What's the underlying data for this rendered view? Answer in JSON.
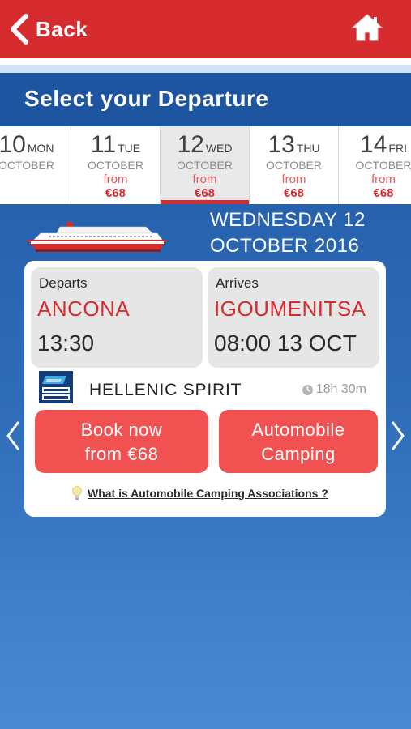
{
  "topbar": {
    "back_label": "Back",
    "home_icon": "home-icon"
  },
  "header": {
    "title": "Select your Departure"
  },
  "dates": [
    {
      "num": "10",
      "day": "MON",
      "month": "OCTOBER",
      "from": "",
      "price": ""
    },
    {
      "num": "11",
      "day": "TUE",
      "month": "OCTOBER",
      "from": "from",
      "price": "€68"
    },
    {
      "num": "12",
      "day": "WED",
      "month": "OCTOBER",
      "from": "from",
      "price": "€68",
      "selected": true
    },
    {
      "num": "13",
      "day": "THU",
      "month": "OCTOBER",
      "from": "from",
      "price": "€68"
    },
    {
      "num": "14",
      "day": "FRI",
      "month": "OCTOBER",
      "from": "from",
      "price": "€68"
    }
  ],
  "selected_date": {
    "line1": "WEDNESDAY 12",
    "line2": "OCTOBER 2016"
  },
  "trip": {
    "departs_label": "Departs",
    "departs_city": "ANCONA",
    "departs_time": "13:30",
    "arrives_label": "Arrives",
    "arrives_city": "IGOUMENITSA",
    "arrives_time": "08:00 13 OCT",
    "operator_logo": "anek-lines-logo",
    "vessel": "HELLENIC SPIRIT",
    "duration": "18h 30m"
  },
  "buttons": {
    "book_line1": "Book now",
    "book_line2": "from €68",
    "camping_line1": "Automobile",
    "camping_line2": "Camping"
  },
  "link": {
    "camping_assoc": "What is Automobile Camping Associations ?"
  },
  "colors": {
    "brand_red": "#d62b2f",
    "button_red": "#f25152",
    "header_blue": "#1d55a0"
  }
}
